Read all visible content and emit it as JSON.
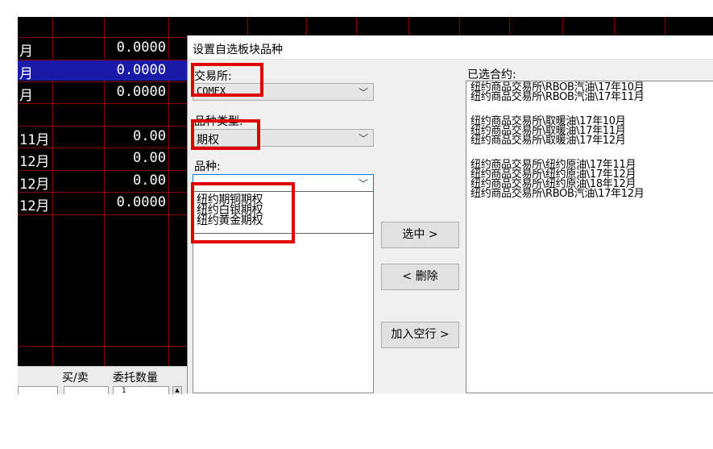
{
  "grid": {
    "rows": [
      {
        "month": "月",
        "value": "0.0000",
        "selected": false
      },
      {
        "month": "月",
        "value": "0.0000",
        "selected": true
      },
      {
        "month": "月",
        "value": "0.0000",
        "selected": false
      },
      {
        "month": "",
        "value": "",
        "selected": false
      },
      {
        "month": "11月",
        "value": "0.00",
        "selected": false
      },
      {
        "month": "12月",
        "value": "0.00",
        "selected": false
      },
      {
        "month": "12月",
        "value": "0.00",
        "selected": false
      },
      {
        "month": "12月",
        "value": "0.0000",
        "selected": false
      }
    ]
  },
  "bottombar": {
    "buysell_label": "买/卖",
    "qty_label": "委托数量",
    "qty_value": "1"
  },
  "dialog": {
    "title": "设置自选板块品种",
    "exchange": {
      "label": "交易所:",
      "value": "COMEX"
    },
    "category": {
      "label": "品种类型:",
      "value": "期权"
    },
    "variety": {
      "label": "品种:",
      "value": "",
      "options": [
        "纽约期铜期权",
        "纽约白银期权",
        "纽约黄金期权"
      ]
    },
    "buttons": {
      "select": "选中 >",
      "delete": "< 删除",
      "add_blank": "加入空行 >"
    },
    "selected_contracts": {
      "label": "已选合约:",
      "items": [
        "纽约商品交易所\\RBOB汽油\\17年10月",
        "纽约商品交易所\\RBOB汽油\\17年11月",
        "",
        "纽约商品交易所\\取暖油\\17年10月",
        "纽约商品交易所\\取暖油\\17年11月",
        "纽约商品交易所\\取暖油\\17年12月",
        "",
        "纽约商品交易所\\纽约原油\\17年11月",
        "纽约商品交易所\\纽约原油\\17年12月",
        "纽约商品交易所\\纽约原油\\18年12月",
        "纽约商品交易所\\RBOB汽油\\17年12月"
      ]
    }
  },
  "colors": {
    "highlight": "#e00000",
    "grid_bg": "#000000",
    "grid_line": "#8a0000",
    "selection": "#1a1aa8"
  }
}
